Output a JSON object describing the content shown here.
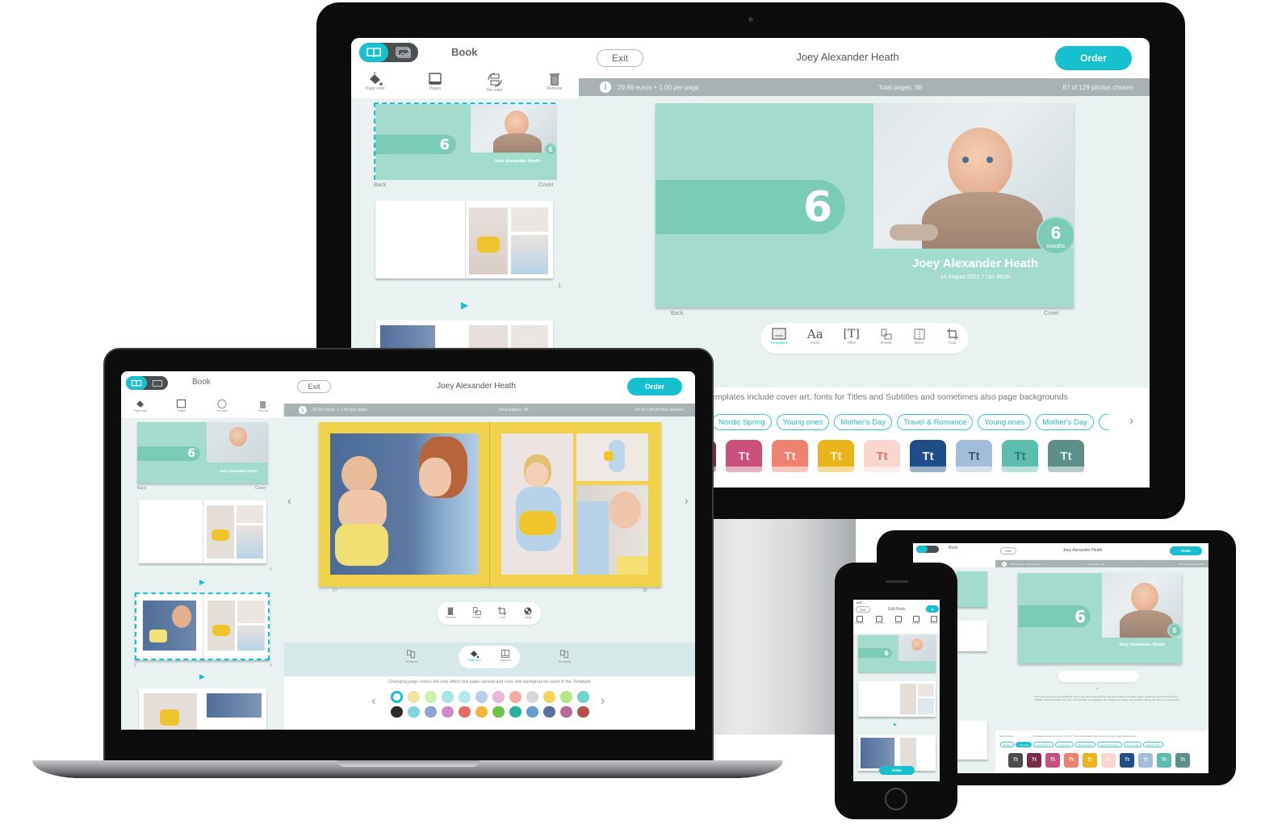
{
  "app": {
    "mode_toggle": {
      "active": "book-icon",
      "inactive": "photos-icon"
    },
    "section_title": "Book",
    "exit_label": "Exit",
    "book_title": "Joey Alexander Heath",
    "order_label": "Order",
    "sidebar_tools": [
      {
        "icon": "paint-bucket-icon",
        "label": "Page color"
      },
      {
        "icon": "pages-icon",
        "label": "Pages"
      },
      {
        "icon": "reorder-icon",
        "label": "Re-order"
      },
      {
        "icon": "trash-icon",
        "label": "Remove"
      }
    ],
    "info_bar": {
      "price": "29,99 euros + 1,00 per page",
      "total_pages": "Total pages: 98",
      "photos_chosen": "87 of 129 photos chosen"
    },
    "accent_color": "#16c0cf",
    "cover_color": "#a3dccd"
  },
  "desktop": {
    "cover": {
      "number": "6",
      "badge_number": "6",
      "badge_label": "months",
      "title": "Joey Alexander Heath",
      "subtitle": "14 August 2022   7 Lbs  85cm",
      "back_label": "Back",
      "cover_label": "Cover"
    },
    "thumbs": [
      {
        "left": "Back",
        "right": "Cover"
      },
      {
        "page_number": "1"
      }
    ],
    "cover_tools": [
      {
        "icon": "templates-icon",
        "label": "Templates",
        "active": true
      },
      {
        "icon": "fonts-icon",
        "glyph": "Aa",
        "label": "Fonts"
      },
      {
        "icon": "titles-icon",
        "glyph": "[T]",
        "label": "Titles"
      },
      {
        "icon": "rotate-icon",
        "label": "Rotate"
      },
      {
        "icon": "mirror-icon",
        "label": "Mirror"
      },
      {
        "icon": "crop-icon",
        "label": "Crop"
      }
    ],
    "templates_hint": "emplates include cover art, fonts for Titles and Subtitles and sometimes also page backgrounds",
    "template_chips": [
      "Nordic Spring",
      "Young ones",
      "Mother's Day",
      "Travel & Romance",
      "Young ones",
      "Mother's Day"
    ],
    "swatch_label": "Tt",
    "swatches": [
      "#7a2946",
      "#c9507a",
      "#ee8270",
      "#e9b31a",
      "#f9d6cf",
      "#1d4e8a",
      "#a3bcd8",
      "#5cbdae",
      "#5d8e88"
    ],
    "swatch_text": [
      "#f3d8e0",
      "#f8dbe6",
      "#fde0d9",
      "#fbeebf",
      "#e8776a",
      "#eaf1fa",
      "#3f5676",
      "#2e7f74",
      "#d6f0eb"
    ]
  },
  "laptop": {
    "page_left": "27",
    "page_right": "28",
    "thumb_labels": {
      "back": "Back",
      "cover": "Cover",
      "p1": "1",
      "p2": "2",
      "p3": "3"
    },
    "photo_tools": [
      {
        "icon": "trash-icon",
        "label": "Remove"
      },
      {
        "icon": "rotate-icon",
        "label": "Rotate"
      },
      {
        "icon": "crop-icon",
        "label": "Crop"
      },
      {
        "icon": "swap-icon",
        "label": "Swap"
      }
    ],
    "spread_tools": [
      {
        "icon": "relayout-icon",
        "label": "Re-layout"
      },
      {
        "icon": "paint-bucket-icon",
        "label": "Page color",
        "active": true
      },
      {
        "icon": "captions-icon",
        "label": "Captions"
      },
      {
        "icon": "relayout-icon",
        "label": "Re-layout"
      }
    ],
    "color_hint": "Changing page colors will only affect this page-spread and over-ride backgrounds used in the Template",
    "page_colors_row1": [
      "#ffffff",
      "#f3e3a0",
      "#cfefb0",
      "#a7e5e0",
      "#b5e7ee",
      "#b9cce8",
      "#e7b7d8",
      "#f5aba3",
      "#d7d7d7",
      "#f4d45a",
      "#b4e782",
      "#6fd3cd"
    ],
    "page_colors_row2": [
      "#2b2b2b",
      "#7fd6da",
      "#8fa2d4",
      "#d18bc4",
      "#ee6b63",
      "#f3b43d",
      "#6bc14c",
      "#2aaea2",
      "#6699cc",
      "#5a7199",
      "#b56a97",
      "#b84f52"
    ],
    "selected_color_index": 0,
    "spread_color": "#f0d24b"
  },
  "tablet": {
    "tip_label": "Tip",
    "tip_text": "This is the Cover of your photobook. Tap on the photo and pick from the photo picker to replace image. Customize your book Title and Subtitles. Pick a template from any of the families of templates in the bottom bar. Finally, you can also change the fonts on any template.",
    "templates_label": "Book Templates",
    "templates_hint": "Templates include cover art, fonts for Titles and Subtitles and sometimes also page backgrounds",
    "chips": [
      "Modern",
      "Pop Style",
      "Nordic Spring",
      "Young ones",
      "Mother's Day",
      "Travel & Romance",
      "Young ones",
      "Mother's Day"
    ],
    "selected_chip": "Pop Style",
    "swatches": [
      "#4b4b4b",
      "#7a2946",
      "#c9507a",
      "#ee8270",
      "#e9b31a",
      "#f9d6cf",
      "#1d4e8a",
      "#a3bcd8",
      "#5cbdae",
      "#5d8e88"
    ]
  },
  "phone": {
    "time": "9:27",
    "exit_label": "Exit",
    "title": "Edit Book",
    "tools": [
      "Templates",
      "Page color",
      "Pages",
      "Re-order",
      "Remove"
    ],
    "order_label": "Order"
  }
}
